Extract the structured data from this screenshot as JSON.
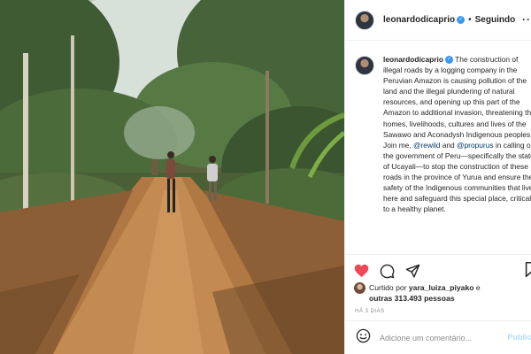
{
  "post": {
    "username": "leonardodicaprio",
    "verified_icon": "verified-badge-icon",
    "follow_separator": "•",
    "follow_status": "Seguindo",
    "more_icon": "more-options-icon",
    "more_label": "···"
  },
  "caption": {
    "username": "leonardodicaprio",
    "text_1": "The construction of illegal roads by a logging company in the Peruvian Amazon is causing pollution of the land and the illegal plundering of natural resources, and opening up this part of the Amazon to additional invasion, threatening the homes, livelihoods, cultures and lives of the Sawawo and Aconadysh Indigenous peoples. Join me,",
    "mention_1": "@rewild",
    "and": "and",
    "mention_2": "@propurus",
    "text_2": "in calling on the government of Peru—specifically the state of Ucayali—to stop the construction of these roads in the province of Yurua and ensure the safety of the Indigenous communities that live here and safeguard this special place, critical to a healthy planet."
  },
  "actions": {
    "like_icon": "heart-filled-icon",
    "comment_icon": "comment-icon",
    "share_icon": "share-icon",
    "save_icon": "bookmark-icon",
    "liked_by_prefix": "Curtido por",
    "liked_by_user": "yara_luiza_piyako",
    "liked_by_joiner": "e",
    "liked_by_others": "outras 313.493 pessoas",
    "time_ago": "HÁ 3 DIAS"
  },
  "comment": {
    "emoji_icon": "emoji-icon",
    "placeholder": "Adicione um comentário...",
    "publish_label": "Publicar"
  },
  "colors": {
    "like_red": "#ed4956",
    "link_blue": "#00376b",
    "verified_blue": "#3897f0",
    "publish_disabled": "#b2dffc"
  }
}
